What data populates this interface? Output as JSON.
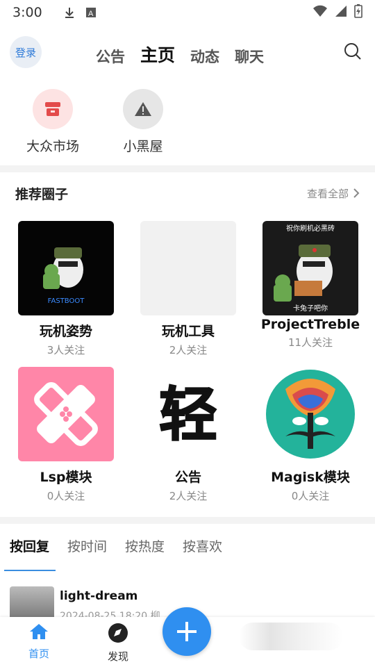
{
  "status": {
    "time": "3:00",
    "icons": [
      "download-icon",
      "text-icon",
      "wifi-icon",
      "signal-icon",
      "battery-icon"
    ]
  },
  "header": {
    "login": "登录",
    "tabs": [
      "公告",
      "主页",
      "动态",
      "聊天"
    ],
    "active_tab": "主页"
  },
  "quick": [
    {
      "label": "大众市场",
      "icon": "store-icon"
    },
    {
      "label": "小黑屋",
      "icon": "warning-icon"
    }
  ],
  "section": {
    "title": "推荐圈子",
    "view_all": "查看全部"
  },
  "circles": [
    {
      "name": "玩机姿势",
      "follow": "3人关注",
      "icon": "fastboot-image"
    },
    {
      "name": "玩机工具",
      "follow": "2人关注",
      "icon": "blank-image"
    },
    {
      "name": "ProjectTreble",
      "follow": "11人关注",
      "icon": "rabbit-image",
      "caption_top": "祝你刷机必黑砖",
      "caption_bottom": "卡兔子吧你"
    },
    {
      "name": "Lsp模块",
      "follow": "0人关注",
      "icon": "bandage-icon"
    },
    {
      "name": "公告",
      "follow": "2人关注",
      "icon": "qing-icon"
    },
    {
      "name": "Magisk模块",
      "follow": "0人关注",
      "icon": "magisk-icon"
    }
  ],
  "sort_tabs": [
    "按回复",
    "按时间",
    "按热度",
    "按喜欢"
  ],
  "post": {
    "author": "light-dream",
    "date": "2024-08-25 18:20 柳"
  },
  "bottom": {
    "home": "首页",
    "discover": "发现"
  },
  "colors": {
    "accent": "#2f8ff0"
  }
}
